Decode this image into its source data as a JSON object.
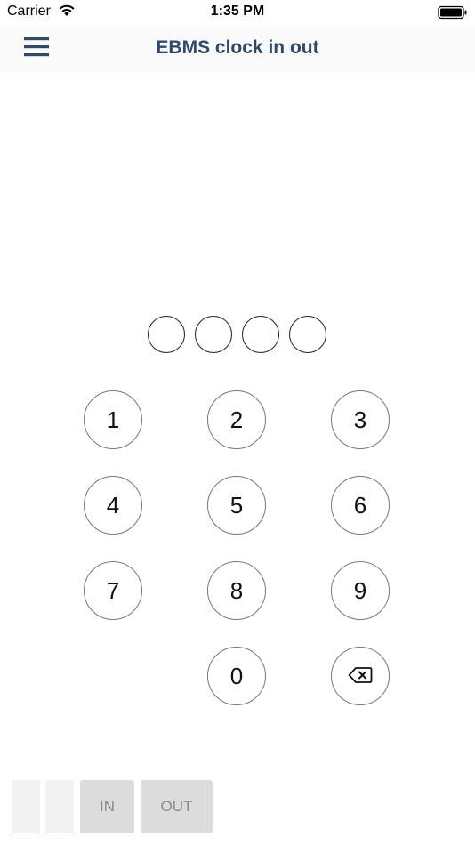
{
  "status_bar": {
    "carrier": "Carrier",
    "time": "1:35 PM",
    "wifi_icon": "wifi-icon",
    "battery_icon": "battery-icon"
  },
  "nav": {
    "title": "EBMS clock in out",
    "menu_icon": "hamburger-menu-icon",
    "title_color": "#2e4a6b"
  },
  "pin": {
    "length": 4,
    "entered": 0
  },
  "keypad": {
    "keys": [
      "1",
      "2",
      "3",
      "4",
      "5",
      "6",
      "7",
      "8",
      "9",
      "0"
    ],
    "backspace_icon": "backspace-icon"
  },
  "bottom": {
    "in_label": "IN",
    "out_label": "OUT"
  }
}
